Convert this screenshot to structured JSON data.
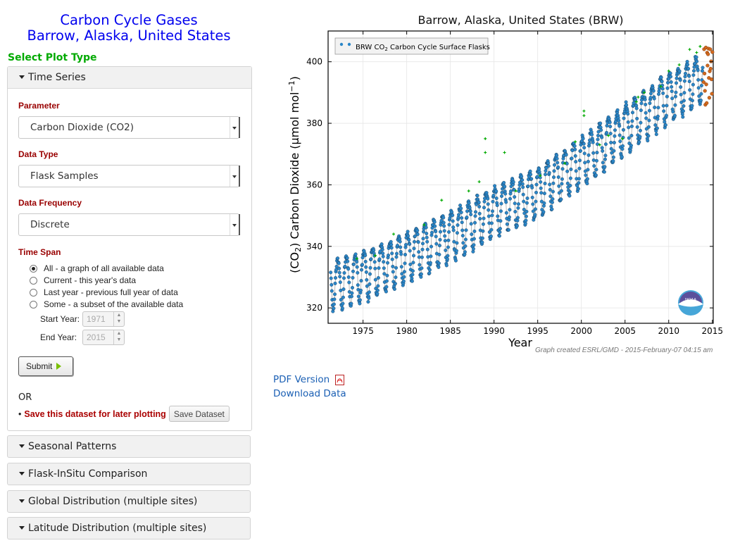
{
  "page": {
    "title_line1": "Carbon Cycle Gases",
    "title_line2": "Barrow, Alaska, United States",
    "select_plot_type": "Select Plot Type"
  },
  "panels": {
    "time_series": "Time Series",
    "seasonal": "Seasonal Patterns",
    "flask_insitu": "Flask-InSitu Comparison",
    "global": "Global Distribution (multiple sites)",
    "latitude": "Latitude Distribution (multiple sites)"
  },
  "form": {
    "parameter_label": "Parameter",
    "parameter_value": "Carbon Dioxide (CO2)",
    "data_type_label": "Data Type",
    "data_type_value": "Flask Samples",
    "frequency_label": "Data Frequency",
    "frequency_value": "Discrete",
    "time_span_label": "Time Span",
    "time_span_options": [
      "All - a graph of all available data",
      "Current - this year's data",
      "Last year - previous full year of data",
      "Some - a subset of the available data"
    ],
    "time_span_selected": 0,
    "start_year_label": "Start Year:",
    "start_year_value": "1971",
    "end_year_label": "End Year:",
    "end_year_value": "2015",
    "submit_label": "Submit",
    "or_text": "OR",
    "bullet": "•",
    "save_text": "Save this dataset for later plotting",
    "save_button": "Save Dataset"
  },
  "links": {
    "pdf": "PDF Version",
    "download": "Download Data"
  },
  "colors": {
    "title_blue": "#0000ee",
    "section_green": "#00aa00",
    "label_red": "#990000",
    "flask_blue": "#2a86c8",
    "outlier_green": "#00aa00",
    "recent_orange": "#d2691e",
    "link_blue": "#1a5fb4"
  },
  "chart_data": {
    "type": "scatter",
    "title": "Barrow, Alaska, United States (BRW)",
    "xlabel": "Year",
    "ylabel_prefix": "(CO",
    "ylabel_sub": "2",
    "ylabel_rest": ") Carbon Dioxide (μmol mol",
    "ylabel_sup": "−1",
    "ylabel_close": ")",
    "xlim": [
      1971,
      2015.1
    ],
    "ylim": [
      315,
      410
    ],
    "x_ticks": [
      1975,
      1980,
      1985,
      1990,
      1995,
      2000,
      2005,
      2010,
      2015
    ],
    "y_ticks": [
      320,
      340,
      360,
      380,
      400
    ],
    "grid": true,
    "legend_position": "top-left",
    "legend_label_pre": "BRW CO",
    "legend_label_sub": "2",
    "legend_label_post": " Carbon Cycle Surface Flasks",
    "credit": "Graph created ESRL/GMD - 2015-February-07 04:15 am",
    "series": [
      {
        "name": "BRW CO2 Carbon Cycle Surface Flasks",
        "trend": {
          "x": [
            1971.5,
            1975,
            1980,
            1985,
            1990,
            1995,
            2000,
            2005,
            2010,
            2014.8
          ],
          "y": [
            330,
            333,
            339,
            346,
            354,
            360,
            370,
            381,
            391,
            399
          ]
        },
        "seasonal_amplitude_high": 5,
        "seasonal_amplitude_low": 11,
        "x_range": [
          1971.3,
          2013.9
        ]
      },
      {
        "name": "outliers",
        "points": [
          [
            1989.0,
            375
          ],
          [
            1989.0,
            370.5
          ],
          [
            1991.2,
            370.5
          ],
          [
            1995.3,
            363
          ],
          [
            1999.3,
            374
          ],
          [
            2000.3,
            384
          ],
          [
            2000.3,
            382.5
          ],
          [
            2003.1,
            376
          ],
          [
            2004.7,
            375
          ],
          [
            2006.3,
            387
          ],
          [
            2006.5,
            388.5
          ],
          [
            2007.2,
            390
          ],
          [
            2009.1,
            392
          ],
          [
            2010.0,
            397
          ],
          [
            2011.2,
            399
          ],
          [
            2012.4,
            404
          ],
          [
            2013.2,
            403
          ],
          [
            2013.6,
            405
          ],
          [
            1987.1,
            358
          ],
          [
            1984.0,
            355
          ],
          [
            1988.3,
            361
          ],
          [
            1992.5,
            358
          ],
          [
            1998.1,
            367
          ],
          [
            2002.1,
            373
          ],
          [
            1982.0,
            347
          ],
          [
            1978.5,
            344
          ],
          [
            1974.3,
            336
          ],
          [
            1976.4,
            337
          ]
        ]
      },
      {
        "name": "recent",
        "x_range": [
          2014.0,
          2015.0
        ],
        "y_range": [
          386,
          406
        ]
      }
    ]
  }
}
